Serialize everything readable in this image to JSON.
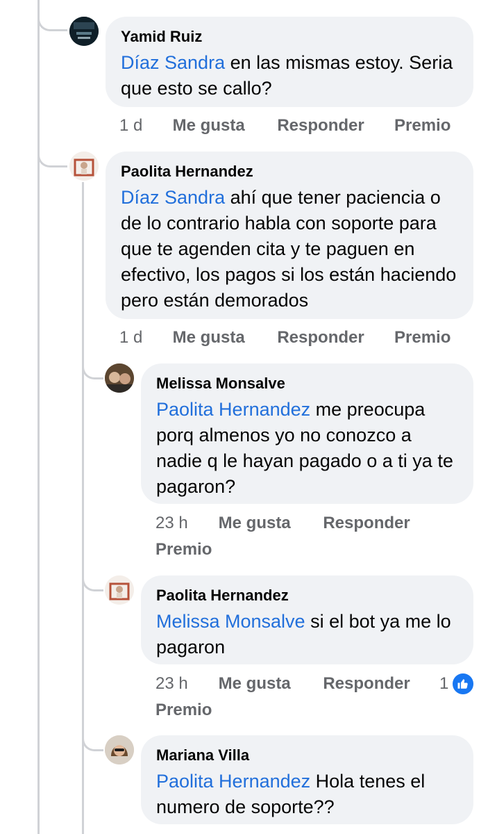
{
  "comments": [
    {
      "author": "Yamid Ruiz",
      "mention": "Díaz Sandra",
      "text": " en las mismas estoy. Seria que esto se callo?",
      "time": "1 d",
      "like": "Me gusta",
      "reply": "Responder",
      "award": "Premio"
    },
    {
      "author": "Paolita Hernandez",
      "mention": "Díaz Sandra",
      "text": " ahí que tener paciencia o de lo contrario habla con soporte para que te agenden cita y te paguen en efectivo, los pagos si los están haciendo pero están demorados",
      "time": "1 d",
      "like": "Me gusta",
      "reply": "Responder",
      "award": "Premio"
    },
    {
      "author": "Melissa Monsalve",
      "mention": "Paolita Hernandez",
      "text": " me preocupa porq almenos yo no conozco a nadie q le hayan pagado o a ti ya te pagaron?",
      "time": "23 h",
      "like": "Me gusta",
      "reply": "Responder",
      "award": "Premio"
    },
    {
      "author": "Paolita Hernandez",
      "mention": "Melissa Monsalve",
      "text": " si el bot ya me lo pagaron",
      "time": "23 h",
      "like": "Me gusta",
      "reply": "Responder",
      "award": "Premio",
      "reaction_count": "1"
    },
    {
      "author": "Mariana Villa",
      "mention": "Paolita Hernandez",
      "text": " Hola tenes el numero de soporte??"
    }
  ],
  "colors": {
    "mention": "#216fdb",
    "bubble": "#f0f2f5",
    "meta": "#65676b",
    "like": "#1877f2"
  },
  "icons": {
    "reaction": "like-thumb-icon"
  }
}
